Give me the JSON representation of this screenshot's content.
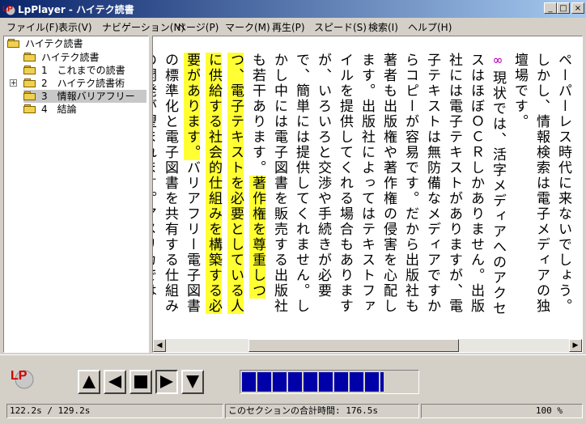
{
  "window": {
    "title": "LpPlayer - ハイテク読書",
    "minimize": "_",
    "maximize": "□",
    "close": "×"
  },
  "menu": [
    {
      "label": "ファイル(F)"
    },
    {
      "label": "表示(V)"
    },
    {
      "label": "ナビゲーション(N)"
    },
    {
      "label": "ページ(P)"
    },
    {
      "label": "マーク(M)"
    },
    {
      "label": "再生(P)"
    },
    {
      "label": "スピード(S)"
    },
    {
      "label": "検索(I)"
    },
    {
      "label": "ヘルプ(H)"
    }
  ],
  "tree": [
    {
      "label": "ハイテク読書",
      "level": 0,
      "expander": "",
      "selected": false
    },
    {
      "label": "ハイテク読書",
      "level": 1,
      "expander": "",
      "selected": false
    },
    {
      "label": "1　これまでの読書",
      "level": 1,
      "expander": "",
      "selected": false
    },
    {
      "label": "2　ハイテク読書術",
      "level": 1,
      "expander": "+",
      "selected": false
    },
    {
      "label": "3　情報バリアフリー",
      "level": 1,
      "expander": "",
      "selected": true
    },
    {
      "label": "4　結論",
      "level": 1,
      "expander": "",
      "selected": false
    }
  ],
  "content": {
    "before": "ペーパーレス時代に来ないでしょう。しかし、情報検索は電子メディアの独壇場です。",
    "marker": "∞",
    "middle": "現状では、活字メディアへのアクセスはほぼＯＣＲしかありません。出版社には電子テキストがありますが、電子テキストは無防備なメディアですからコピーが容易です。だから出版社も著者も出版権や著作権の侵害を心配します。出版社によってはテキストファイルを提供してくれる場合もありますが、いろいろと交渉や手続きが必要で、簡単には提供してくれません。しかし中には電子図書を販売する出版社も若干あります。",
    "highlight": "著作権を尊重しつつ、電子テキストを必要としている人に供給する社会的仕組みを構築する必要があります。",
    "after": "バリアフリー電子図書の標準化と電子図書を共有する仕組みの開発が望まれます。アメリカではbookshare.orgとい"
  },
  "controls": {
    "buttons": [
      {
        "name": "up-button",
        "icon": "arrow-up-icon"
      },
      {
        "name": "rewind-button",
        "icon": "arrow-left-icon"
      },
      {
        "name": "stop-button",
        "icon": "stop-icon"
      },
      {
        "name": "play-button",
        "icon": "play-icon"
      },
      {
        "name": "down-button",
        "icon": "arrow-down-icon"
      }
    ],
    "progress_fraction": 0.81,
    "progress_color": "#0000a8"
  },
  "status": {
    "time": "122.2s / 129.2s",
    "section_total": "このセクションの合計時間:  176.5s",
    "zoom": "100 %"
  }
}
